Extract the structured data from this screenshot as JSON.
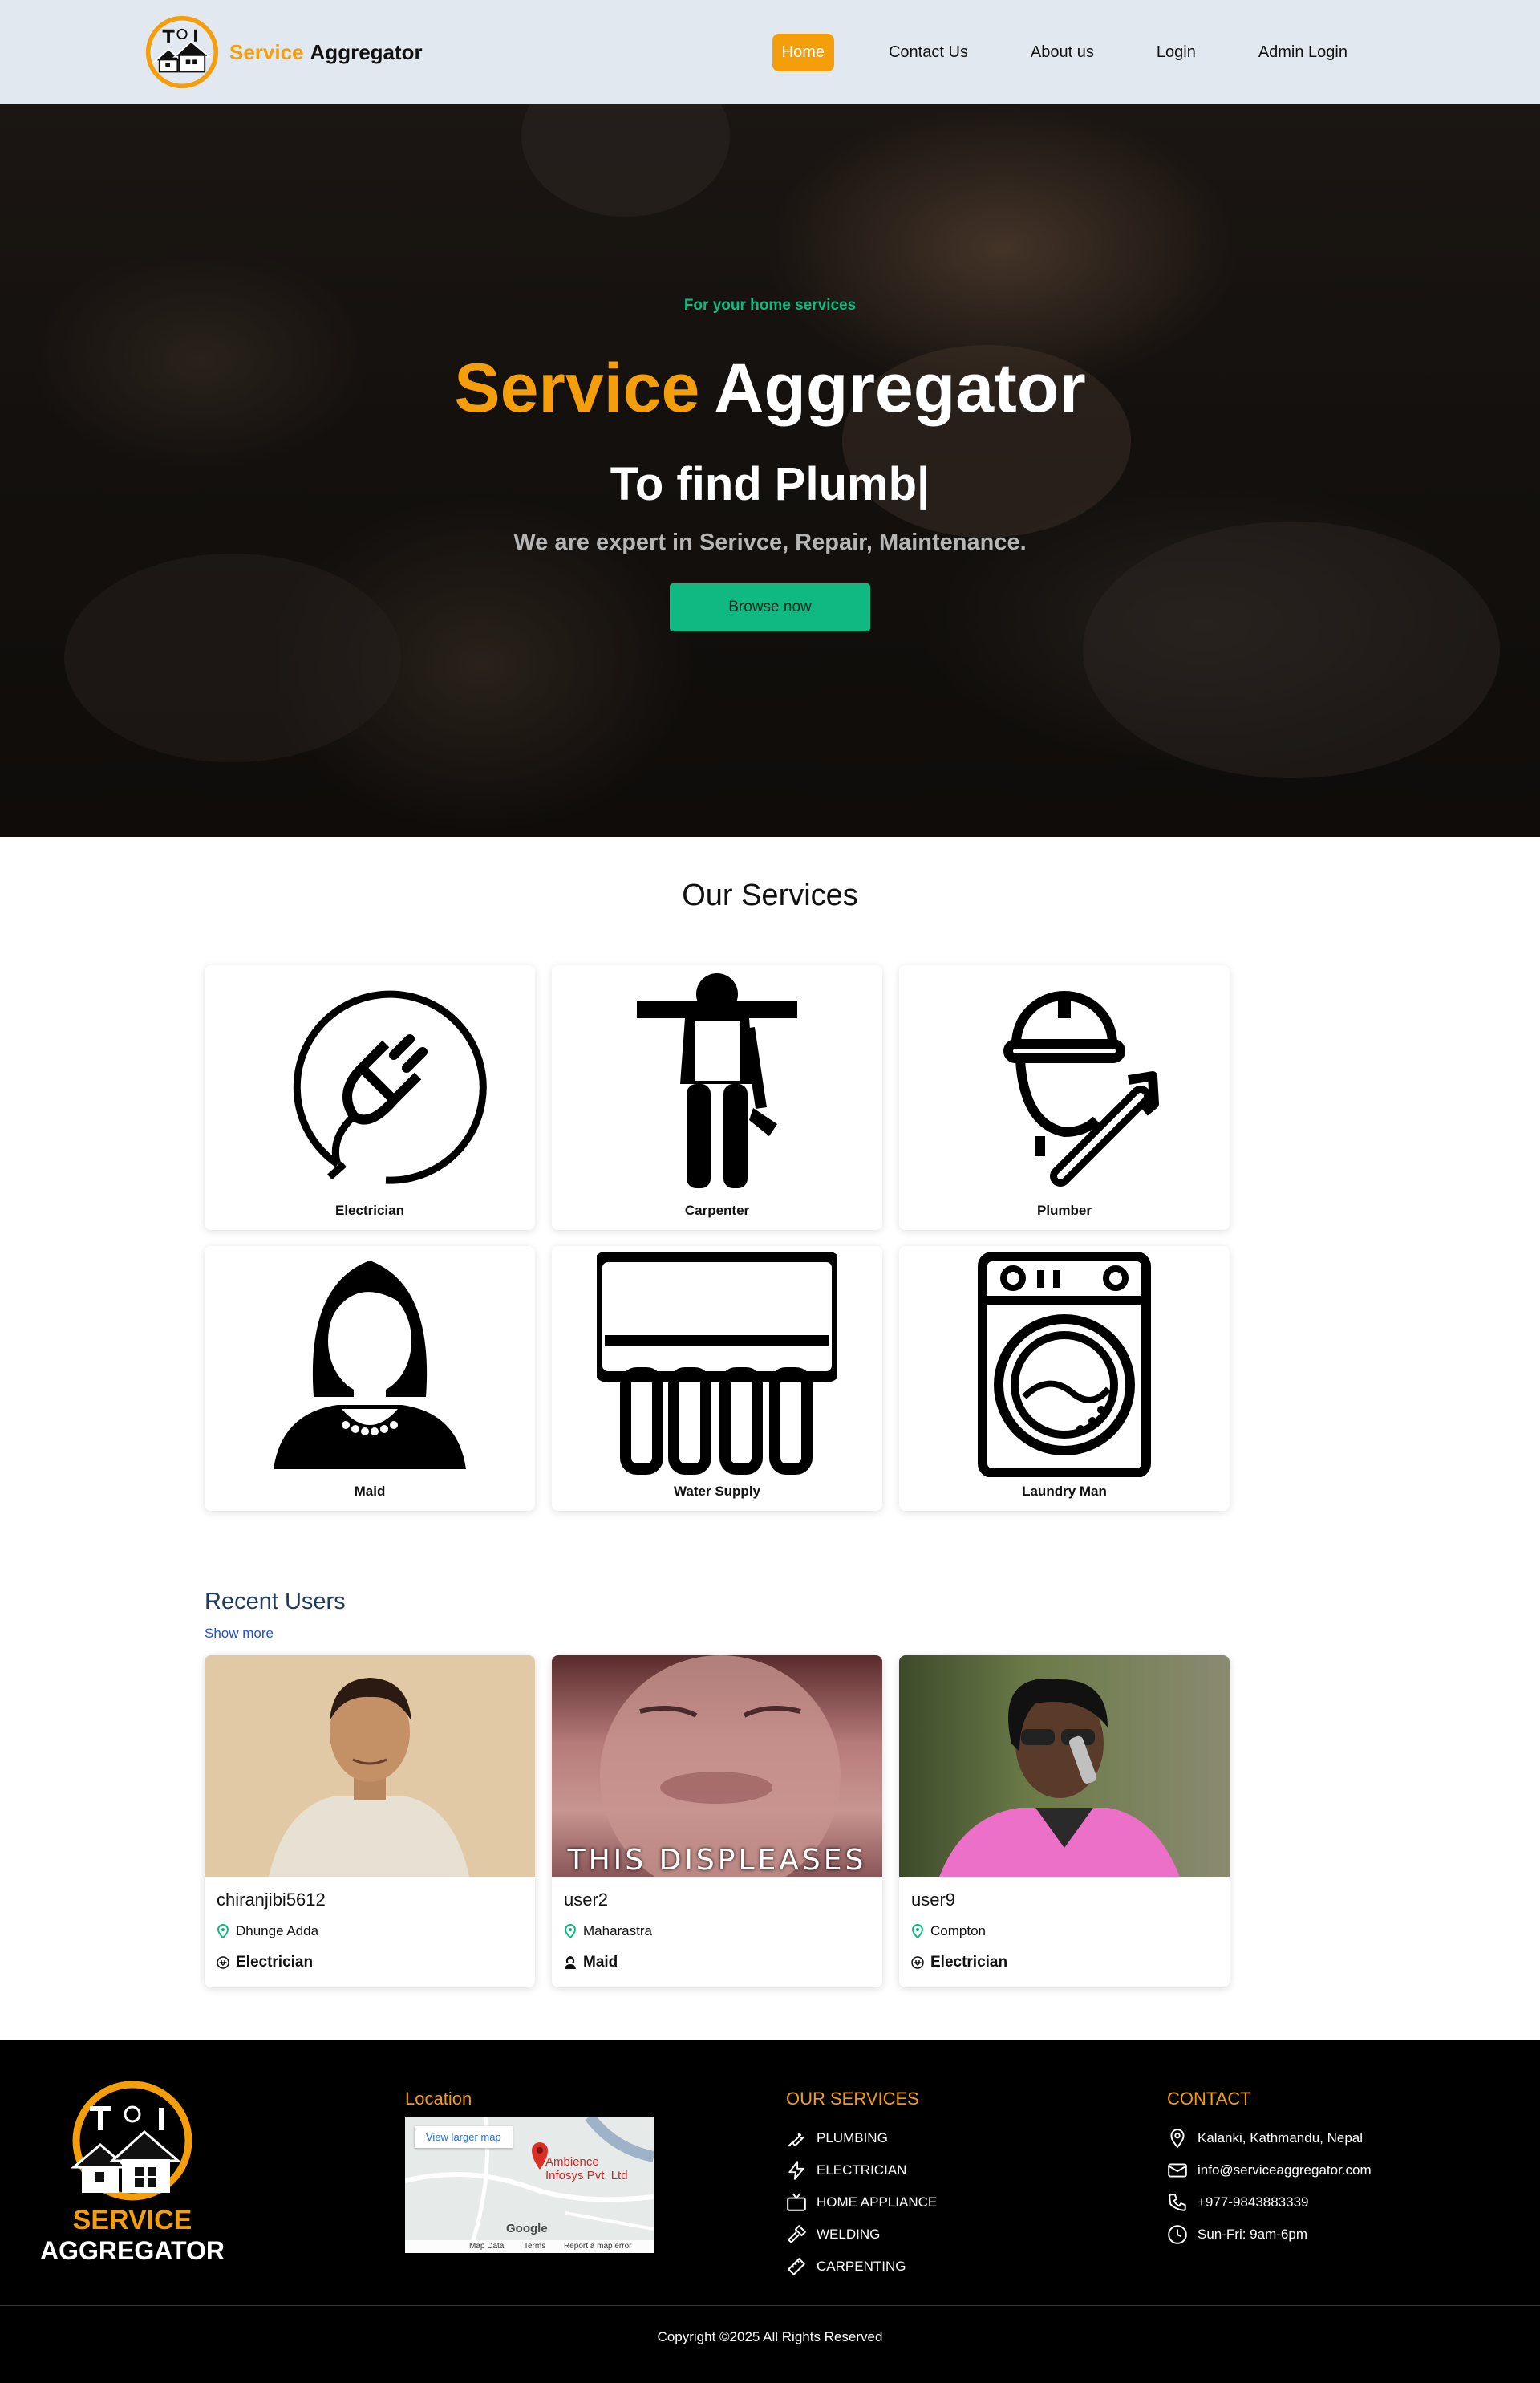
{
  "nav": {
    "brand_part1": "Service",
    "brand_part2": "Aggregator",
    "links": [
      "Home",
      "Contact Us",
      "About us",
      "Login",
      "Admin Login"
    ],
    "active_link": "Home"
  },
  "hero": {
    "tagline": "For your home services",
    "title_part1": "Service",
    "title_part2": "Aggregator",
    "typing_text": "To find Plumb|",
    "subtitle": "We are expert in Serivce, Repair, Maintenance.",
    "button_label": "Browse now"
  },
  "services": {
    "title": "Our Services",
    "items": [
      {
        "label": "Electrician",
        "icon": "plug-icon"
      },
      {
        "label": "Carpenter",
        "icon": "carpenter-icon"
      },
      {
        "label": "Plumber",
        "icon": "plumber-icon"
      },
      {
        "label": "Maid",
        "icon": "maid-icon"
      },
      {
        "label": "Water Supply",
        "icon": "water-supply-icon"
      },
      {
        "label": "Laundry Man",
        "icon": "washing-machine-icon"
      }
    ]
  },
  "recent_users": {
    "title": "Recent Users",
    "show_more": "Show more",
    "users": [
      {
        "name": "chiranjibi5612",
        "location": "Dhunge Adda",
        "profession": "Electrician",
        "caption": ""
      },
      {
        "name": "user2",
        "location": "Maharastra",
        "profession": "Maid",
        "caption": "THIS DISPLEASES"
      },
      {
        "name": "user9",
        "location": "Compton",
        "profession": "Electrician",
        "caption": ""
      }
    ]
  },
  "footer": {
    "logo_line1": "SERVICE",
    "logo_line2": "AGGREGATOR",
    "location_heading": "Location",
    "map": {
      "view_larger": "View larger map",
      "place_name_line1": "Ambience",
      "place_name_line2": "Infosys Pvt. Ltd",
      "google": "Google",
      "map_data": "Map Data",
      "terms": "Terms",
      "report": "Report a map error"
    },
    "services_heading": "OUR SERVICES",
    "services": [
      "PLUMBING",
      "ELECTRICIAN",
      "HOME APPLIANCE",
      "WELDING",
      "CARPENTING"
    ],
    "contact_heading": "CONTACT",
    "contact": {
      "address": "Kalanki, Kathmandu, Nepal",
      "email": "info@serviceaggregator.com",
      "phone": "+977-9843883339",
      "hours": "Sun-Fri: 9am-6pm"
    },
    "copyright": "Copyright ©2025 All Rights Reserved"
  },
  "colors": {
    "accent": "#f59e0b",
    "green": "#10b981",
    "nav_bg": "#e2e8f0",
    "footer_bg": "#000000"
  }
}
